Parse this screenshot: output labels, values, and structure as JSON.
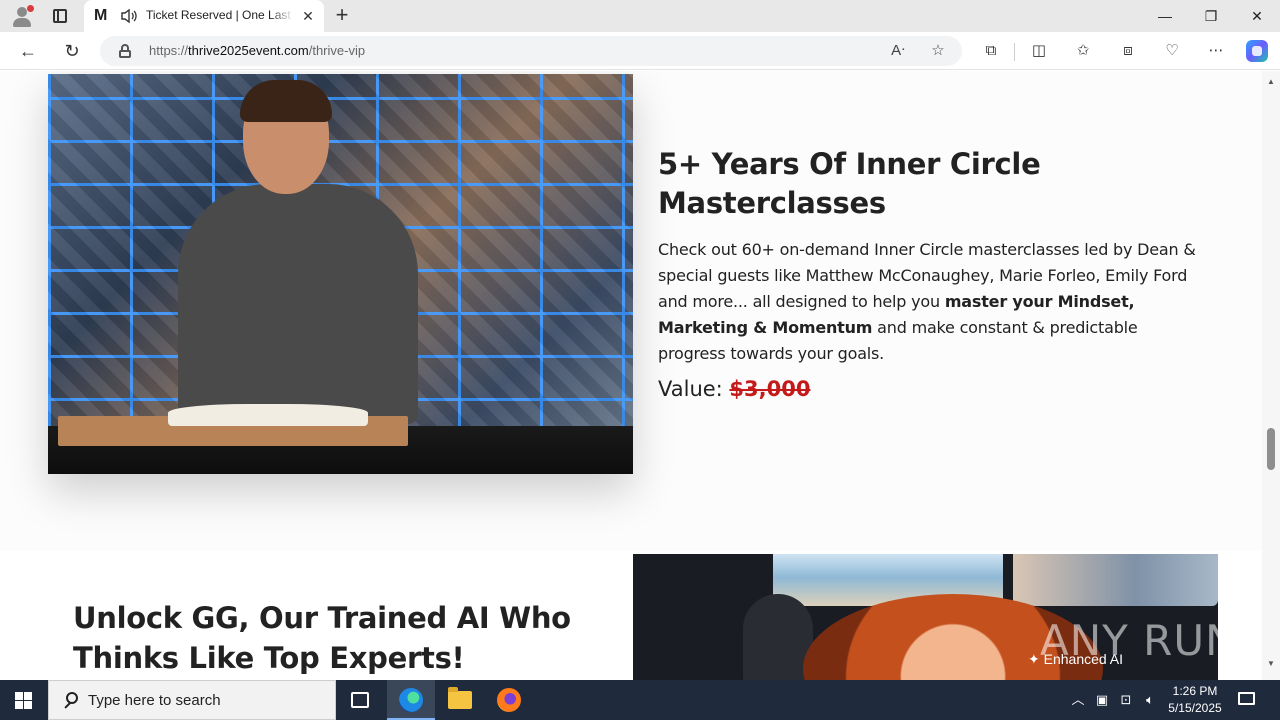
{
  "browser": {
    "tab_title": "Ticket Reserved | One Last Step",
    "tab_favicon_letter": "M",
    "url_protocol": "https://",
    "url_host": "thrive2025event.com",
    "url_path": "/thrive-vip"
  },
  "section1": {
    "headline": "5+ Years Of Inner Circle Masterclasses",
    "para_part1": "Check out 60+ on-demand Inner Circle masterclasses led by Dean & special guests like Matthew McConaughey, Marie Forleo, Emily Ford and more... all designed to help you ",
    "para_bold": "master your Mindset, Marketing & Momentum",
    "para_part2": " and make constant & predictable progress towards your goals.",
    "value_label": "Value: ",
    "value_price": "$3,000"
  },
  "section2": {
    "headline": "Unlock GG, Our Trained AI Who Thinks Like Top Experts!",
    "image_caption": "✦ Enhanced AI"
  },
  "watermark": "ANY RUN",
  "taskbar": {
    "search_placeholder": "Type here to search",
    "time": "1:26 PM",
    "date": "5/15/2025"
  },
  "colors": {
    "price_red": "#c41a1a",
    "taskbar": "#1f2a3c",
    "heading_text": "#222222"
  }
}
